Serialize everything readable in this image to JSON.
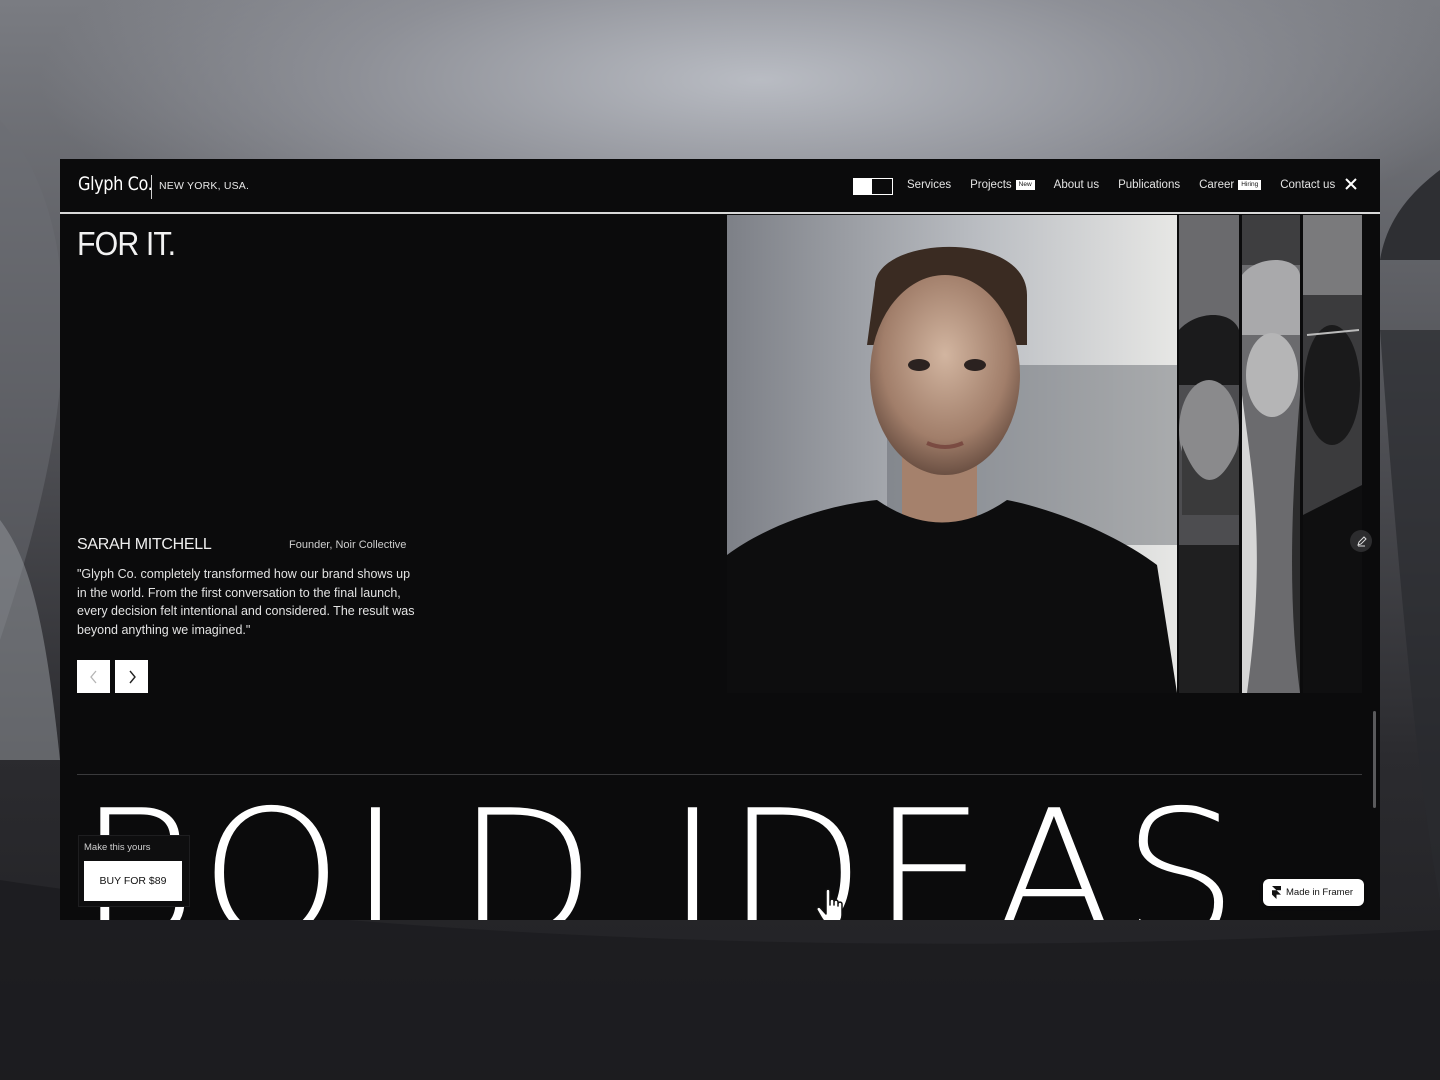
{
  "nav": {
    "logo": "Glyph Co.",
    "location": "NEW YORK, USA.",
    "items": [
      {
        "label": "Services",
        "tag": ""
      },
      {
        "label": "Projects",
        "tag": "New"
      },
      {
        "label": "About us",
        "tag": ""
      },
      {
        "label": "Publications",
        "tag": ""
      },
      {
        "label": "Career",
        "tag": "Hiring"
      },
      {
        "label": "Contact us",
        "tag": ""
      }
    ],
    "close_icon": "close-icon",
    "theme_toggle_icon": "theme-toggle-icon"
  },
  "hero": {
    "heading": "FOR IT."
  },
  "testimonial": {
    "name": "SARAH MITCHELL",
    "role": "Founder, Noir Collective",
    "quote": "\"Glyph Co. completely transformed how our brand shows up in the world. From the first conversation to the final launch, every decision felt intentional and considered. The result was beyond anything we imagined.\"",
    "prev_icon": "chevron-left-icon",
    "next_icon": "chevron-right-icon"
  },
  "banner": {
    "text": "BOLD IDEAS"
  },
  "buy": {
    "caption": "Make this yours",
    "button": "BUY FOR $89"
  },
  "framer": {
    "label": "Made in Framer"
  }
}
